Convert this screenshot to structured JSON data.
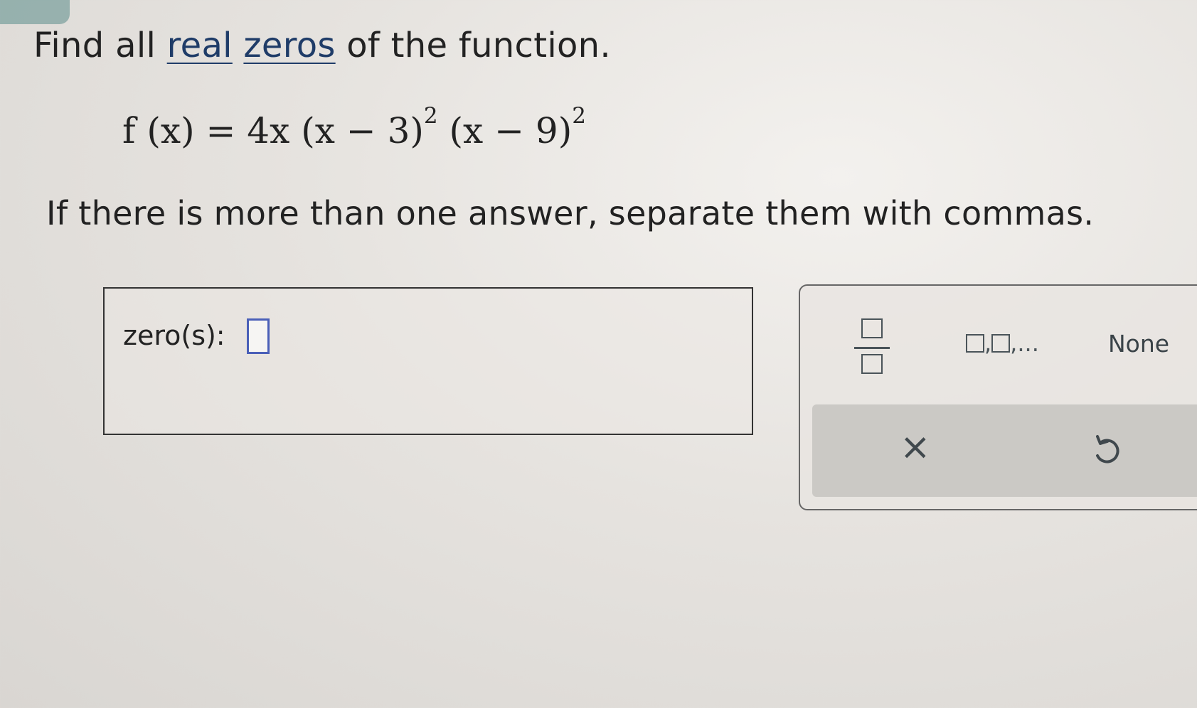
{
  "question": {
    "prefix": "Find all ",
    "link_real": "real",
    "link_zeros": "zeros",
    "suffix": " of the function."
  },
  "equation": {
    "lhs": "f (x) = 4x (x − 3)",
    "exp1": "2",
    "mid": " (x − 9)",
    "exp2": "2"
  },
  "instructions": "If there is more than one answer, separate them with commas.",
  "answer": {
    "label": "zero(s):",
    "value": ""
  },
  "keypad": {
    "list_key_label": ",",
    "list_key_suffix": ",...",
    "none_label": "None",
    "clear_symbol": "×"
  },
  "colors": {
    "link": "#1f3c68",
    "input_border": "#4a5fb8",
    "accent_tab": "#8aa9a6"
  },
  "icons": {
    "fraction": "fraction-icon",
    "list": "list-icon",
    "clear": "close-icon",
    "undo": "undo-icon"
  }
}
